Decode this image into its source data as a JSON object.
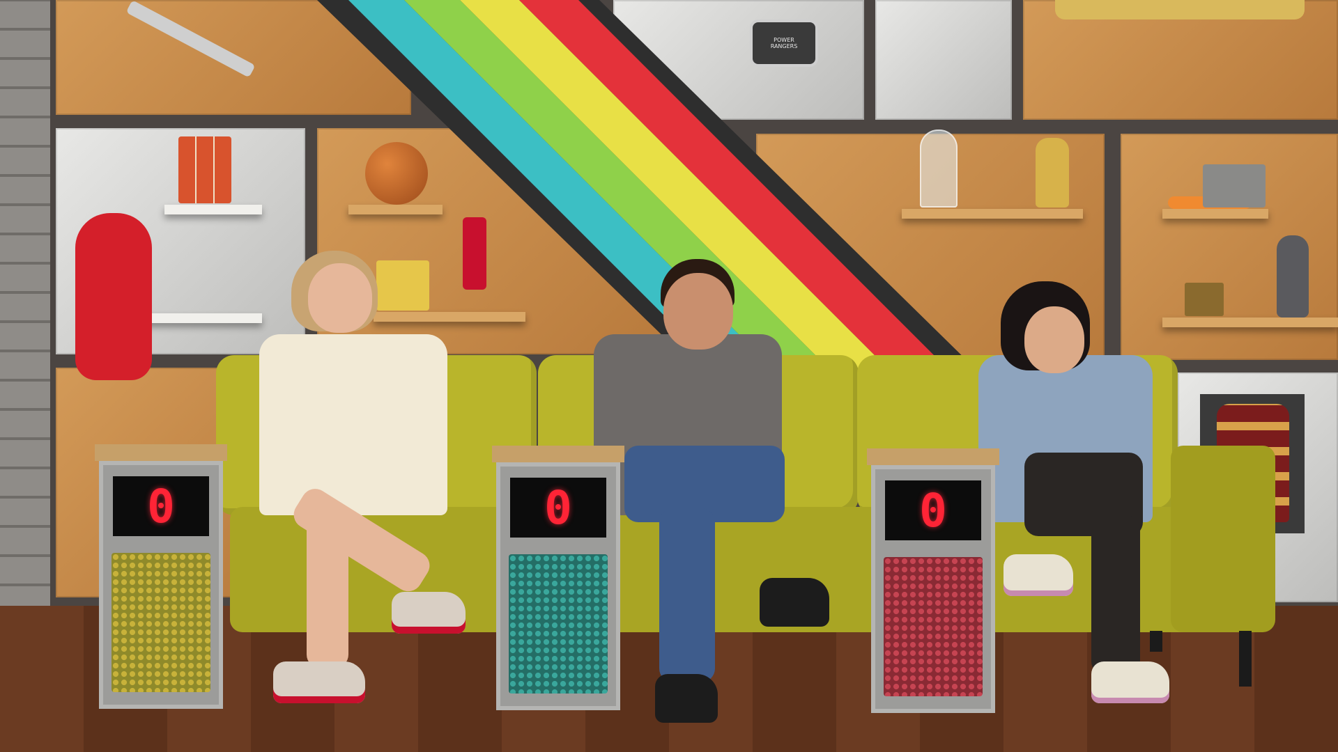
{
  "podiums": [
    {
      "score": "0",
      "grille_color": "#c8b23a"
    },
    {
      "score": "0",
      "grille_color": "#3aa79c"
    },
    {
      "score": "0",
      "grille_color": "#c64452"
    }
  ],
  "colors": {
    "sofa": "#b9b52b",
    "wall_panel": "#c98c4c",
    "floor": "#6b3b22",
    "stripe_colors": [
      "#3cbfc4",
      "#8fd14a",
      "#e8e046",
      "#e4323a"
    ]
  },
  "signs": {
    "power_badge": "POWER RANGERS"
  }
}
